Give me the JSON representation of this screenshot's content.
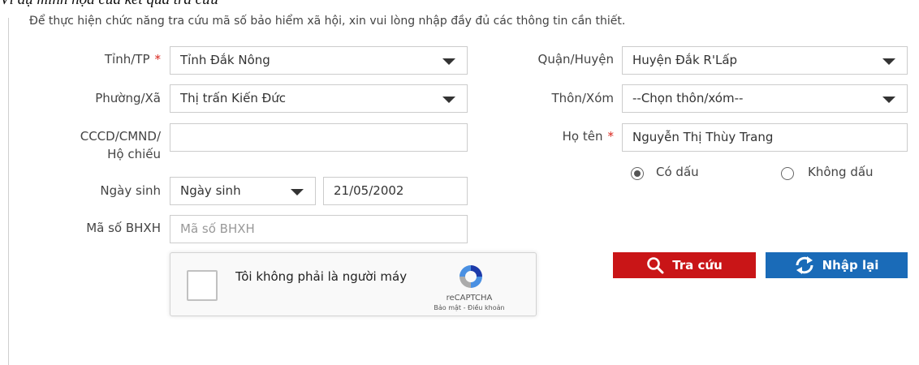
{
  "caption": "Ví dụ minh họa của kết quả tra cứu",
  "notice": "Để thực hiện chức năng tra cứu mã số bảo hiểm xã hội, xin vui lòng nhập đầy đủ các thông tin cần thiết.",
  "fields": {
    "province": {
      "label": "Tỉnh/TP",
      "required_mark": "*",
      "value": "Tỉnh Đắk Nông"
    },
    "district": {
      "label": "Quận/Huyện",
      "value": "Huyện Đắk R'Lấp"
    },
    "ward": {
      "label": "Phường/Xã",
      "value": "Thị trấn Kiến Đức"
    },
    "hamlet": {
      "label": "Thôn/Xóm",
      "value": "--Chọn thôn/xóm--"
    },
    "id_number": {
      "label_line1": "CCCD/CMND/",
      "label_line2": "Hộ chiếu",
      "value": ""
    },
    "full_name": {
      "label": "Họ tên",
      "required_mark": "*",
      "value": "Nguyễn Thị Thùy Trang"
    },
    "dob": {
      "label": "Ngày sinh",
      "type_value": "Ngày sinh",
      "date_value": "21/05/2002"
    },
    "bhxh": {
      "label": "Mã số BHXH",
      "placeholder": "Mã số BHXH"
    }
  },
  "accent": {
    "option_with": "Có dấu",
    "option_without": "Không dấu",
    "selected": "Có dấu"
  },
  "captcha": {
    "text": "Tôi không phải là người máy",
    "brand": "reCAPTCHA",
    "links": "Bảo mật - Điều khoản"
  },
  "buttons": {
    "search": "Tra cứu",
    "reset": "Nhập lại"
  },
  "colors": {
    "search_button": "#c91517",
    "reset_button": "#1a6bb8",
    "required": "#d9251c"
  },
  "icons": {
    "search": "search-icon",
    "reset": "refresh-icon",
    "captcha_logo": "recaptcha-logo-icon"
  }
}
